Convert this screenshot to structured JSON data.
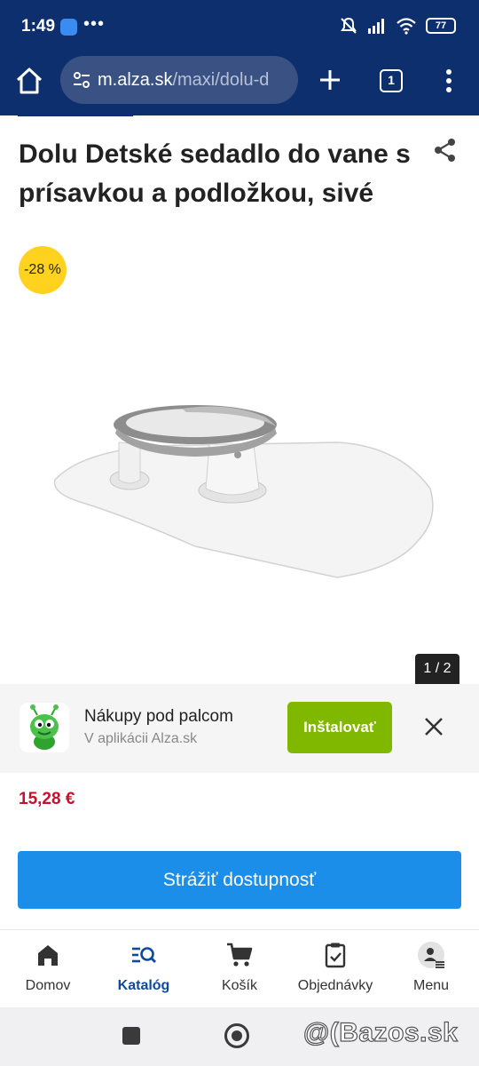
{
  "status_bar": {
    "time": "1:49",
    "more": "•••",
    "battery": "77"
  },
  "browser": {
    "url_domain": "m.alza.sk",
    "url_path": "/maxi/dolu-d",
    "tab_count": "1"
  },
  "product": {
    "title": "Dolu Detské sedadlo do vane s prísavkou a podložkou, sivé",
    "discount": "-28 %",
    "image_counter": "1 / 2",
    "price": "15,28 €",
    "watch_button": "Strážiť dostupnosť"
  },
  "app_banner": {
    "name": "Nákupy pod palcom",
    "subtitle": "V aplikácii Alza.sk",
    "install_label": "Inštalovať"
  },
  "bottom_nav": {
    "items": [
      {
        "label": "Domov",
        "icon": "home-icon"
      },
      {
        "label": "Katalóg",
        "icon": "catalog-search-icon",
        "active": true
      },
      {
        "label": "Košík",
        "icon": "cart-icon"
      },
      {
        "label": "Objednávky",
        "icon": "orders-clipboard-icon"
      },
      {
        "label": "Menu",
        "icon": "user-menu-icon"
      }
    ]
  },
  "watermark": "@(Bazos.sk",
  "colors": {
    "brand_navy": "#0d2f6e",
    "discount_yellow": "#ffd21f",
    "price_red": "#c8102e",
    "install_green": "#80b800",
    "button_blue": "#1a8ee8",
    "active_nav": "#0d4aa0"
  }
}
